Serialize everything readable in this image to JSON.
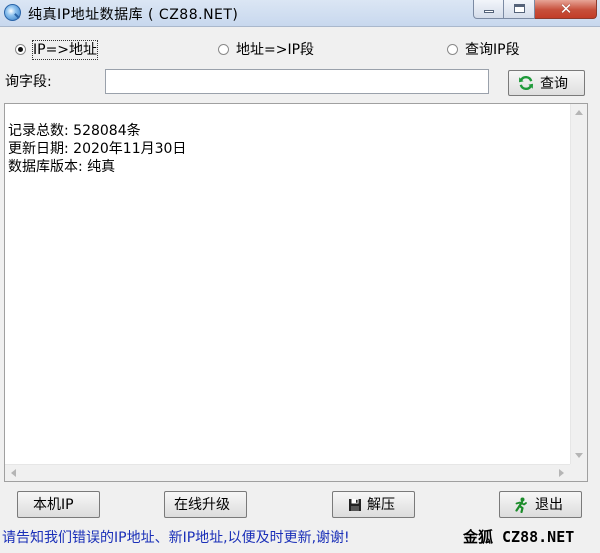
{
  "window": {
    "title": "纯真IP地址数据库 ( CZ88.NET)",
    "controls": {
      "minimize": "minimize-icon",
      "maximize": "maximize-icon",
      "close": "✕"
    }
  },
  "modes": {
    "options": [
      {
        "label": "IP=>地址",
        "selected": true
      },
      {
        "label": "地址=>IP段",
        "selected": false
      },
      {
        "label": "查询IP段",
        "selected": false
      }
    ]
  },
  "query": {
    "label": "询字段:",
    "input_value": "",
    "button_label": "查询",
    "button_icon": "refresh-icon"
  },
  "result": {
    "lines": [
      "记录总数: 528084条",
      "更新日期: 2020年11月30日",
      "数据库版本: 纯真"
    ]
  },
  "buttons": {
    "local_ip": "本机IP",
    "online_upgrade": "在线升级",
    "unzip": "解压",
    "unzip_icon": "floppy-disk-icon",
    "exit": "退出",
    "exit_icon": "running-man-icon"
  },
  "status": {
    "message": "请告知我们错误的IP地址、新IP地址,以便及时更新,谢谢!",
    "brand": "金狐 CZ88.NET"
  },
  "colors": {
    "status_text": "#1a2fb8",
    "close_button": "#c74f3b",
    "exit_icon": "#1c8c2a",
    "refresh_icon": "#1f9a3a"
  }
}
